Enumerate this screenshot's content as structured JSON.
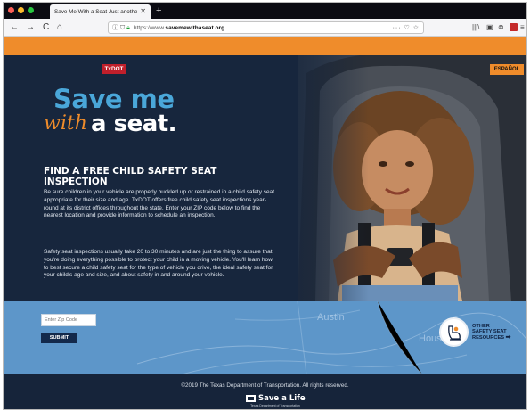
{
  "browser": {
    "tab_title": "Save Me With a Seat Just another",
    "tab_close": "✕",
    "new_tab": "+",
    "nav": {
      "back": "←",
      "forward": "→",
      "reload": "C",
      "home": "⌂"
    },
    "url_prefix": "https://www.",
    "url_domain": "savemewithaseat.org",
    "url_actions": "··· ♡ ☆"
  },
  "header": {
    "txdot_label": "TxDOT",
    "espanol_label": "ESPAÑOL"
  },
  "logo": {
    "line1": "Save me",
    "with": "with",
    "line2": "a seat."
  },
  "content": {
    "heading": "FIND A FREE CHILD SAFETY SEAT INSPECTION",
    "paragraph1": "Be sure children in your vehicle are properly buckled up or restrained in a child safety seat appropriate for their size and age. TxDOT offers free child safety seat inspections year-round at its district offices throughout the state. Enter your ZIP code below to find the nearest location and provide information to schedule an inspection.",
    "paragraph2": "Safety seat inspections usually take 20 to 30 minutes and are just the thing to assure that you're doing everything possible to protect your child in a moving vehicle. You'll learn how to best secure a child safety seat for the type of vehicle you drive, the ideal safety seat for your child's age and size, and about safety in and around your vehicle."
  },
  "zip_form": {
    "placeholder": "Enter Zip Code",
    "submit_label": "SUBMIT"
  },
  "resources": {
    "line1": "OTHER",
    "line2": "SAFETY SEAT",
    "line3": "RESOURCES"
  },
  "map_labels": {
    "city1": "Austin",
    "city2": "Houst"
  },
  "footer": {
    "copyright": "©2019 The Texas Department of Transportation. All rights reserved.",
    "brand": "Save a Life",
    "brand_sub": "Texas Department of Transportation"
  },
  "colors": {
    "brand_orange": "#ef8c2b",
    "navy": "#17263d",
    "logo_blue": "#4aa7d9",
    "txdot_red": "#c01f2b",
    "zip_band_blue": "#5d96c9"
  }
}
